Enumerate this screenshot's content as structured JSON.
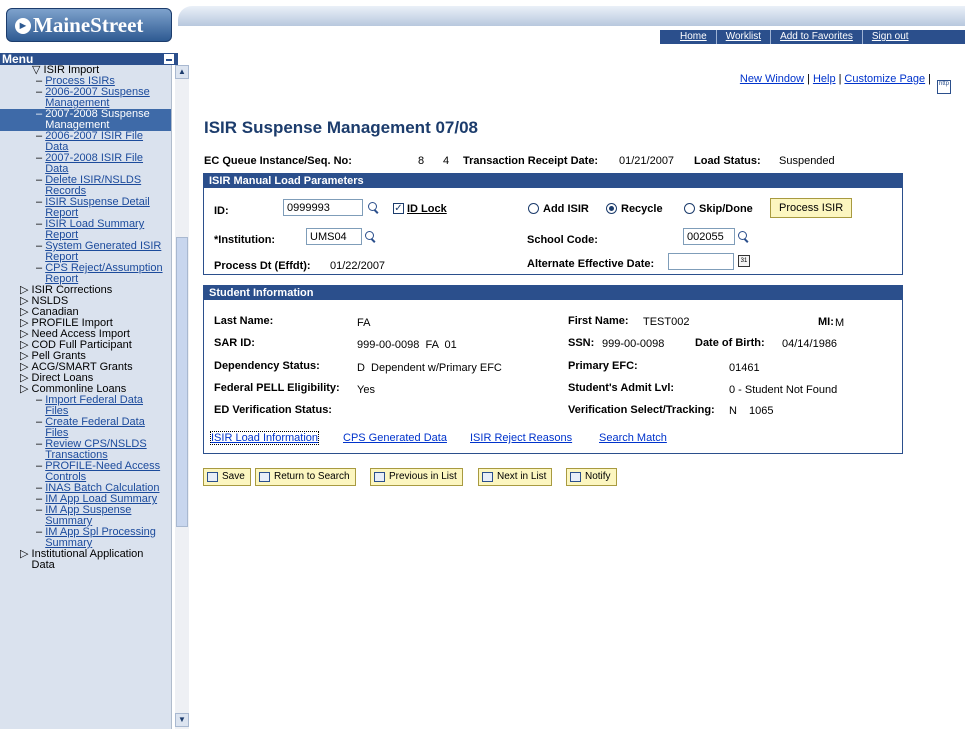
{
  "brand": {
    "logo_text": "MaineStreet"
  },
  "nav": {
    "home": "Home",
    "worklist": "Worklist",
    "favorites": "Add to Favorites",
    "signout": "Sign out"
  },
  "menu": {
    "title": "Menu",
    "items": [
      {
        "prefix": "▽ ",
        "label": "ISIR Import",
        "link": false
      },
      {
        "prefix": "– ",
        "label": "Process ISIRs",
        "link": true
      },
      {
        "prefix": "– ",
        "label": "2006-2007 Suspense Management",
        "link": true
      },
      {
        "prefix": "– ",
        "label": "2007-2008 Suspense Management",
        "link": false,
        "selected": true
      },
      {
        "prefix": "– ",
        "label": "2006-2007 ISIR File Data",
        "link": true
      },
      {
        "prefix": "– ",
        "label": "2007-2008 ISIR File Data",
        "link": true
      },
      {
        "prefix": "– ",
        "label": "Delete ISIR/NSLDS Records",
        "link": true
      },
      {
        "prefix": "– ",
        "label": "ISIR Suspense Detail Report",
        "link": true
      },
      {
        "prefix": "– ",
        "label": "ISIR Load Summary Report",
        "link": true
      },
      {
        "prefix": "– ",
        "label": "System Generated ISIR Report",
        "link": true
      },
      {
        "prefix": "– ",
        "label": "CPS Reject/Assumption Report",
        "link": true
      },
      {
        "prefix": "▷ ",
        "label": "ISIR Corrections",
        "link": false
      },
      {
        "prefix": "▷ ",
        "label": "NSLDS",
        "link": false
      },
      {
        "prefix": "▷ ",
        "label": "Canadian",
        "link": false
      },
      {
        "prefix": "▷ ",
        "label": "PROFILE Import",
        "link": false
      },
      {
        "prefix": "▷ ",
        "label": "Need Access Import",
        "link": false
      },
      {
        "prefix": "▷ ",
        "label": "COD Full Participant",
        "link": false
      },
      {
        "prefix": "▷ ",
        "label": "Pell Grants",
        "link": false
      },
      {
        "prefix": "▷ ",
        "label": "ACG/SMART Grants",
        "link": false
      },
      {
        "prefix": "▷ ",
        "label": "Direct Loans",
        "link": false
      },
      {
        "prefix": "▷ ",
        "label": "Commonline Loans",
        "link": false
      },
      {
        "prefix": "– ",
        "label": "Import Federal Data Files",
        "link": true
      },
      {
        "prefix": "– ",
        "label": "Create Federal Data Files",
        "link": true
      },
      {
        "prefix": "– ",
        "label": "Review CPS/NSLDS Transactions",
        "link": true
      },
      {
        "prefix": "– ",
        "label": "PROFILE-Need Access Controls",
        "link": true
      },
      {
        "prefix": "– ",
        "label": "INAS Batch Calculation",
        "link": true
      },
      {
        "prefix": "– ",
        "label": "IM App Load Summary",
        "link": true
      },
      {
        "prefix": "– ",
        "label": "IM App Suspense Summary",
        "link": true
      },
      {
        "prefix": "– ",
        "label": "IM App Spl Processing Summary",
        "link": true
      },
      {
        "prefix": "▷ ",
        "label": "Institutional Application Data",
        "link": false
      }
    ]
  },
  "toplinks": {
    "new_window": "New Window",
    "help": "Help",
    "customize": "Customize Page",
    "sep": "|",
    "nttp": "http"
  },
  "page": {
    "title": "ISIR Suspense Management 07/08"
  },
  "header": {
    "queue_label": "EC Queue Instance/Seq. No:",
    "queue_instance": "8",
    "queue_seq": "4",
    "trans_label": "Transaction Receipt Date:",
    "trans_date": "01/21/2007",
    "status_label": "Load Status:",
    "status_value": "Suspended"
  },
  "params": {
    "title": "ISIR Manual Load Parameters",
    "id_label": "ID:",
    "id_value": "0999993",
    "idlock_label": "ID Lock",
    "idlock_checked": true,
    "radio_add": "Add ISIR",
    "radio_recycle": "Recycle",
    "radio_skip": "Skip/Done",
    "selected_action": "Recycle",
    "process_button": "Process ISIR",
    "inst_label": "*Institution:",
    "inst_value": "UMS04",
    "school_label": "School Code:",
    "school_value": "002055",
    "pdt_label": "Process Dt (Effdt):",
    "pdt_value": "01/22/2007",
    "alt_label": "Alternate Effective Date:",
    "alt_value": ""
  },
  "student": {
    "title": "Student Information",
    "last_label": "Last Name:",
    "last_value": "FA",
    "first_label": "First Name:",
    "first_value": "TEST002",
    "mi_label": "MI:",
    "mi_value": "M",
    "sar_label": "SAR ID:",
    "sar_value": "999-00-0098  FA  01",
    "ssn_label": "SSN:",
    "ssn_value": "999-00-0098",
    "dob_label": "Date of Birth:",
    "dob_value": "04/14/1986",
    "dep_label": "Dependency Status:",
    "dep_value": "D  Dependent w/Primary EFC",
    "efc_label": "Primary EFC:",
    "efc_value": "01461",
    "pell_label": "Federal PELL Eligibility:",
    "pell_value": "Yes",
    "admit_label": "Student's Admit Lvl:",
    "admit_value": "0 - Student Not Found",
    "edver_label": "ED Verification Status:",
    "edver_value": "",
    "versel_label": "Verification Select/Tracking:",
    "versel_flag": "N",
    "versel_track": "1065",
    "tabs": [
      "ISIR Load Information",
      "CPS Generated Data",
      "ISIR Reject Reasons",
      "Search Match"
    ]
  },
  "toolbar": {
    "save": "Save",
    "return": "Return to Search",
    "prev": "Previous in List",
    "next": "Next in List",
    "notify": "Notify"
  },
  "colors": {
    "header_blue": "#2b4f8c",
    "menu_bg": "#dae2ee",
    "selected_bg": "#3e6aa8",
    "button_yellow": "#fcf6c0",
    "link": "#0033cc"
  }
}
